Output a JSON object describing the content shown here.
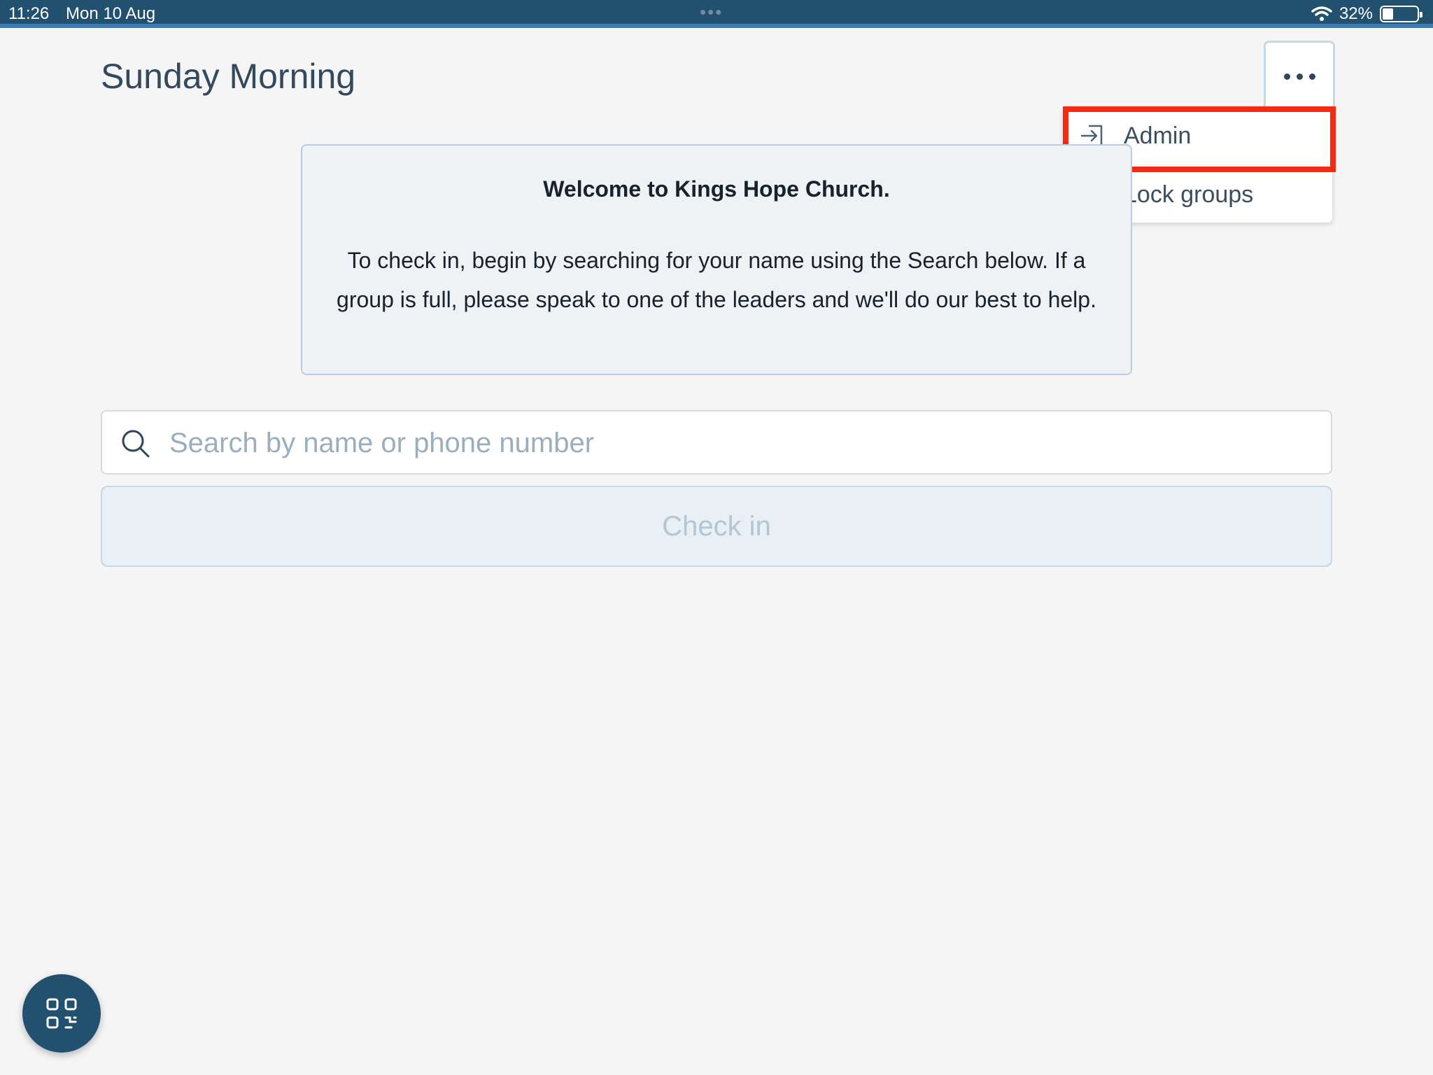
{
  "status_bar": {
    "time": "11:26",
    "date": "Mon 10 Aug",
    "battery": "32%",
    "battery_level": 0.32
  },
  "header": {
    "title": "Sunday Morning"
  },
  "menu": {
    "items": [
      {
        "label": "Admin",
        "icon": "login-arrow-icon",
        "highlighted": true
      },
      {
        "label": "Lock groups",
        "icon": "group-icon",
        "highlighted": false
      }
    ],
    "highlight_color": "#f42a13"
  },
  "welcome": {
    "title": "Welcome to Kings Hope Church.",
    "body": "To check in, begin by searching for your name using the Search below. If a group is full, please speak to one of the leaders and we'll do our best to help."
  },
  "search": {
    "placeholder": "Search by name or phone number",
    "value": ""
  },
  "checkin": {
    "label": "Check in",
    "enabled": false
  },
  "colors": {
    "brand": "#22506f",
    "background": "#f4f5f4"
  }
}
